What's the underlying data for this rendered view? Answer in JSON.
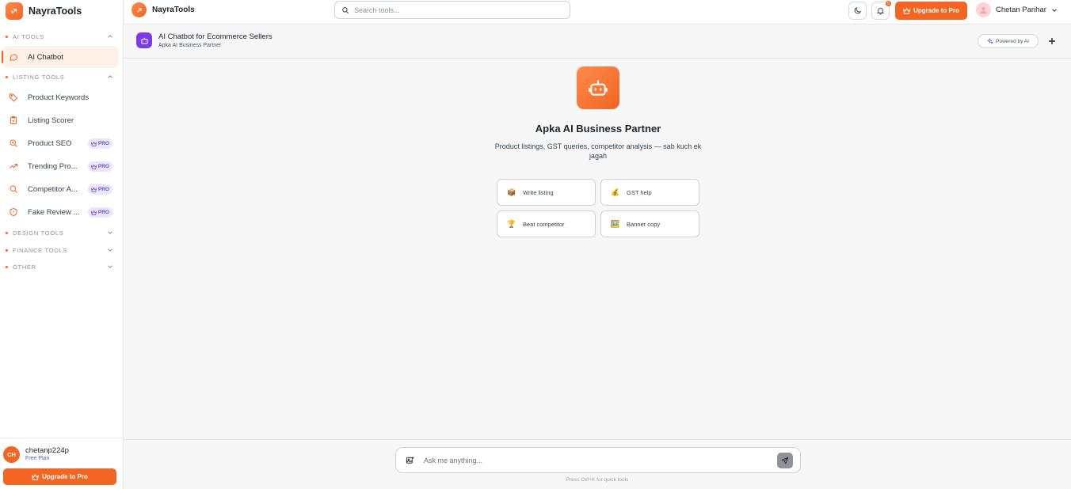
{
  "app": {
    "name": "NayraTools"
  },
  "sidebar": {
    "sections": [
      {
        "label": "AI TOOLS"
      },
      {
        "label": "LISTING TOOLS"
      },
      {
        "label": "DESIGN TOOLS"
      },
      {
        "label": "FINANCE TOOLS"
      },
      {
        "label": "OTHER"
      }
    ],
    "items": [
      {
        "label": "AI Chatbot",
        "icon": "chat-bubble-icon",
        "active": true
      },
      {
        "label": "Product Keywords",
        "icon": "tag-icon"
      },
      {
        "label": "Listing Scorer",
        "icon": "clipboard-check-icon"
      },
      {
        "label": "Product SEO",
        "icon": "search-zoom-icon",
        "badge": "PRO"
      },
      {
        "label": "Trending Pro...",
        "icon": "trending-up-icon",
        "badge": "PRO"
      },
      {
        "label": "Competitor A...",
        "icon": "search-icon",
        "badge": "PRO"
      },
      {
        "label": "Fake Review ...",
        "icon": "shield-icon",
        "badge": "PRO"
      }
    ],
    "user": {
      "initials": "CH",
      "username": "chetanp224p",
      "plan": "Free Plan"
    },
    "upgrade_label": "Upgrade to Pro"
  },
  "topbar": {
    "brand": "NayraTools",
    "search_placeholder": "Search tools...",
    "notification_count": "5",
    "upgrade_label": "Upgrade to Pro",
    "user_name": "Chetan Parihar"
  },
  "chat": {
    "title": "AI Chatbot for Ecommerce Sellers",
    "subtitle": "Apka AI Business Partner",
    "powered_label": "Powered by AI",
    "hero_title": "Apka AI Business Partner",
    "hero_subtitle": "Product listings, GST queries, competitor analysis — sab kuch ek jagah",
    "suggestions": [
      {
        "emoji": "📦",
        "label": "Write listing"
      },
      {
        "emoji": "💰",
        "label": "GST help"
      },
      {
        "emoji": "🏆",
        "label": "Beat competitor"
      },
      {
        "emoji": "🖼️",
        "label": "Banner copy"
      }
    ],
    "input_placeholder": "Ask me anything...",
    "hint": "Press Ctrl+K for quick tools"
  },
  "colors": {
    "accent": "#f26522",
    "header_icon": "#7c3aed",
    "pro_badge_bg": "#ece6fb",
    "pro_badge_text": "#6b4fd1"
  }
}
